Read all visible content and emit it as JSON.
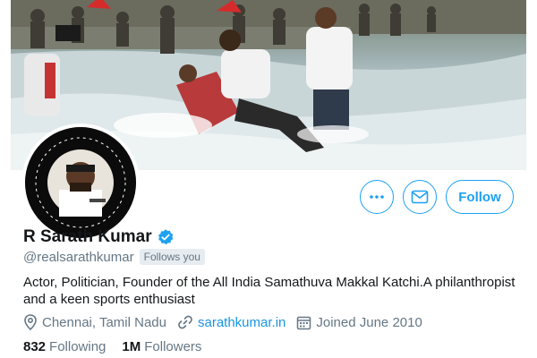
{
  "profile": {
    "name": "R Sarath Kumar",
    "handle": "@realsarathkumar",
    "follows_you": "Follows you",
    "bio": "Actor, Politician, Founder of the All India Samathuva Makkal Katchi.A philanthropist and a keen sports enthusiast",
    "location": "Chennai, Tamil Nadu",
    "website": "sarathkumar.in",
    "joined": "Joined June 2010",
    "verified": true
  },
  "stats": {
    "following_count": "832",
    "following_label": "Following",
    "followers_count": "1M",
    "followers_label": "Followers"
  },
  "actions": {
    "more_icon": "more-horizontal-icon",
    "message_icon": "envelope-icon",
    "follow_label": "Follow"
  },
  "icons": {
    "verified": "verified-badge-icon",
    "location": "location-pin-icon",
    "link": "link-icon",
    "calendar": "calendar-icon"
  },
  "colors": {
    "accent": "#1da1f2",
    "link": "#1b95e0",
    "secondary_text": "#657786",
    "primary_text": "#14171a"
  }
}
